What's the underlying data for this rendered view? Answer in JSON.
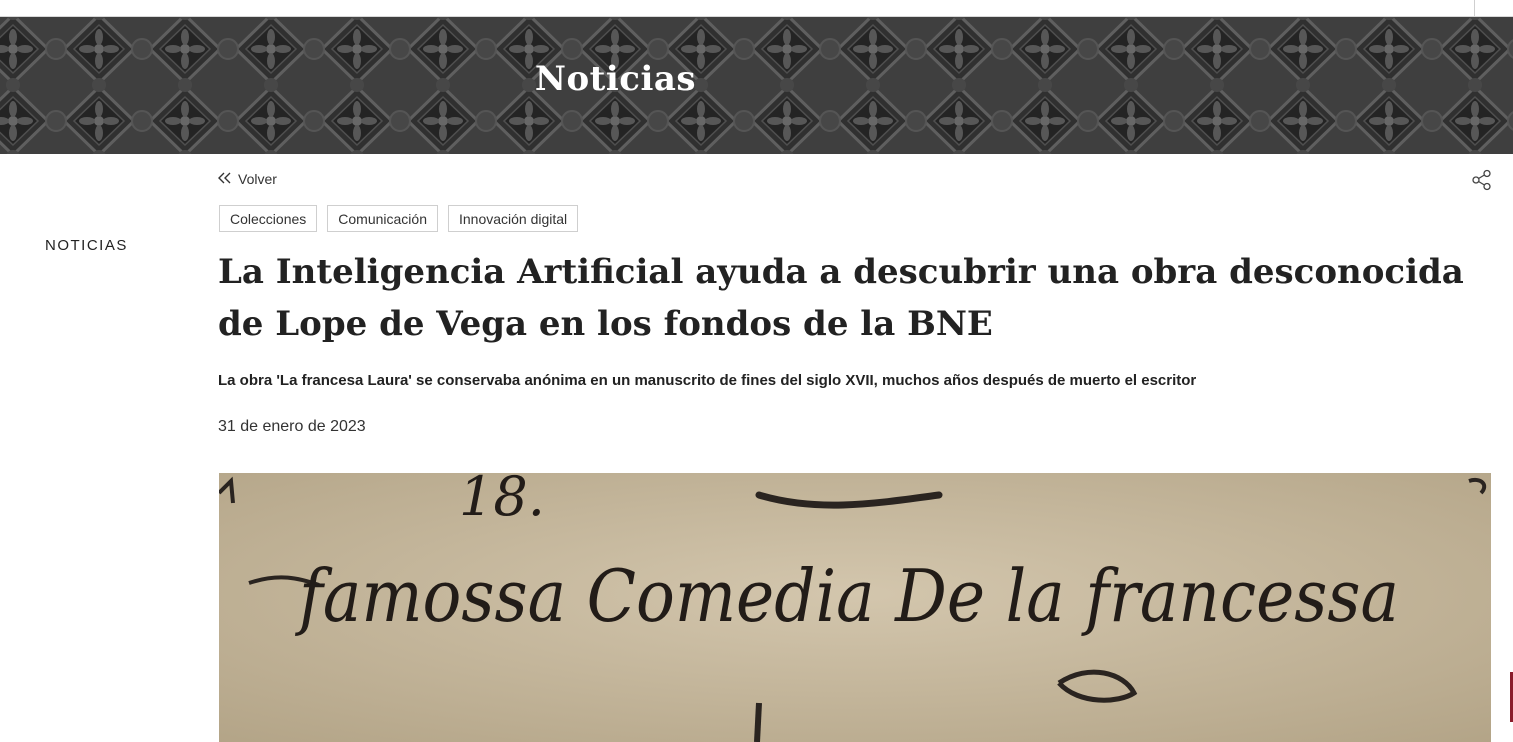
{
  "banner": {
    "title": "Noticias"
  },
  "nav": {
    "back_label": "Volver"
  },
  "tags": [
    "Colecciones",
    "Comunicación",
    "Innovación digital"
  ],
  "sidebar": {
    "section_label": "NOTICIAS"
  },
  "article": {
    "title": "La Inteligencia Artificial ayuda a descubrir una obra desconocida de Lope de Vega en los fondos de la BNE",
    "subtitle": "La obra 'La francesa Laura' se conservaba anónima en un manuscrito de fines del siglo XVII, muchos años después de muerto el escritor",
    "date": "31 de enero de 2023"
  },
  "image": {
    "handwriting_line1": "18.",
    "handwriting_line2": "famossa Comedia De la francessa"
  },
  "icons": {
    "back": "double-chevron-left-icon",
    "share": "share-icon"
  },
  "colors": {
    "accent": "#8a1c2b",
    "banner": "#4f4f4f",
    "parchment": "#c7b9a0"
  }
}
